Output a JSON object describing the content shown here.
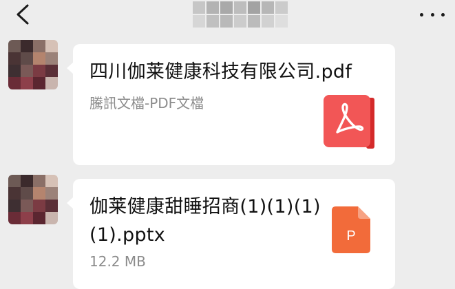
{
  "header": {
    "back_icon": "chevron-left-icon",
    "title_obscured": true,
    "more_icon": "more-horizontal-icon"
  },
  "messages": [
    {
      "sender_avatar": "pixelated-avatar",
      "file_name": "四川伽莱健康科技有限公司.pdf",
      "subtitle": "騰訊文檔-PDF文檔",
      "icon": "pdf-file-icon"
    },
    {
      "sender_avatar": "pixelated-avatar",
      "file_name": "伽莱健康甜睡招商(1)(1)(1)(1).pptx",
      "subtitle": "12.2 MB",
      "icon": "pptx-file-icon",
      "icon_letter": "P"
    }
  ],
  "colors": {
    "background": "#ededed",
    "bubble": "#ffffff",
    "pdf_red": "#f25656",
    "ppt_orange": "#f26b3a"
  }
}
